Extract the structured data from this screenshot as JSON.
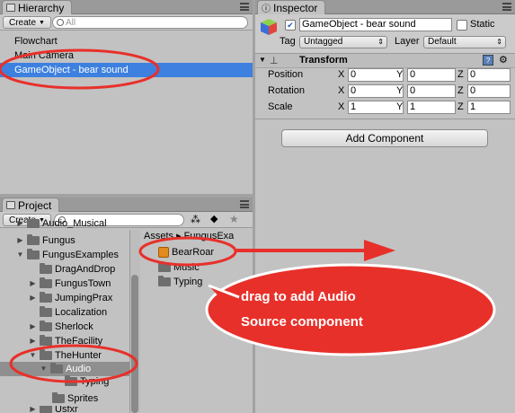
{
  "hierarchy": {
    "tab_label": "Hierarchy",
    "create_label": "Create",
    "search_placeholder": "All",
    "items": [
      "Flowchart",
      "Main Camera",
      "GameObject - bear sound"
    ]
  },
  "project": {
    "tab_label": "Project",
    "create_label": "Create",
    "tree": [
      "Audio_Musical",
      "Fungus",
      "FungusExamples",
      "DragAndDrop",
      "FungusTown",
      "JumpingPrax",
      "Localization",
      "Sherlock",
      "TheFacility",
      "TheHunter",
      "Audio",
      "Typing",
      "Sprites",
      "Usfxr"
    ],
    "breadcrumb": [
      "Assets",
      "FungusExa"
    ],
    "assets": [
      "BearRoar",
      "Music",
      "Typing"
    ]
  },
  "inspector": {
    "tab_label": "Inspector",
    "object_name": "GameObject - bear sound",
    "static_label": "Static",
    "tag_label": "Tag",
    "tag_value": "Untagged",
    "layer_label": "Layer",
    "layer_value": "Default",
    "component_title": "Transform",
    "rows": [
      {
        "label": "Position",
        "x": "0",
        "y": "0",
        "z": "0"
      },
      {
        "label": "Rotation",
        "x": "0",
        "y": "0",
        "z": "0"
      },
      {
        "label": "Scale",
        "x": "1",
        "y": "1",
        "z": "1"
      }
    ],
    "axis_x": "X",
    "axis_y": "Y",
    "axis_z": "Z",
    "add_component_label": "Add Component"
  },
  "annotation": {
    "line1": "drag to add Audio",
    "line2": "Source component",
    "color": "#e8302a"
  }
}
